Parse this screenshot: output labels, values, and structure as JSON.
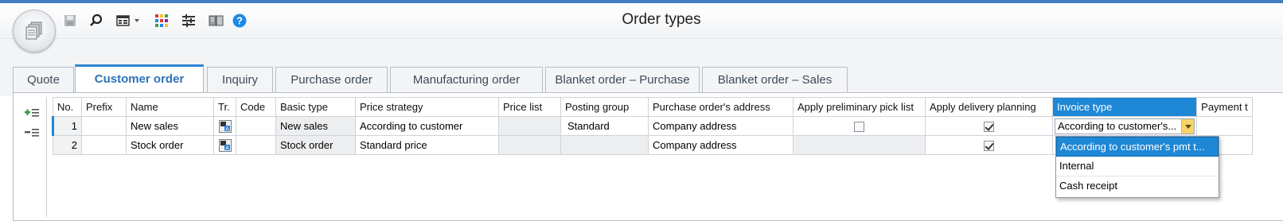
{
  "window": {
    "title": "Order types",
    "accent_color": "#3f7fbf"
  },
  "quick_access": {
    "icons": [
      "save-icon",
      "search-icon",
      "view-icon",
      "dropdown-arrow-icon",
      "color-grid-icon",
      "list-settings-icon",
      "book-icon",
      "help-icon"
    ]
  },
  "tabs": [
    {
      "label": "Quote"
    },
    {
      "label": "Customer order",
      "active": true
    },
    {
      "label": "Inquiry"
    },
    {
      "label": "Purchase order"
    },
    {
      "label": "Manufacturing order"
    },
    {
      "label": "Blanket order – Purchase"
    },
    {
      "label": "Blanket order – Sales"
    }
  ],
  "grid": {
    "columns": [
      "No.",
      "Prefix",
      "Name",
      "Tr.",
      "Code",
      "Basic type",
      "Price strategy",
      "Price list",
      "Posting group",
      "Purchase order's address",
      "Apply preliminary pick list",
      "Apply delivery planning",
      "Invoice type",
      "Payment t"
    ],
    "selected_column": "Invoice type",
    "rows": [
      {
        "no": "1",
        "prefix": "",
        "name": "New sales",
        "code": "",
        "basic_type": "New sales",
        "price_strategy": "According to customer",
        "price_list": "",
        "posting_group": "Standard",
        "address": "Company address",
        "apply_pick_list": false,
        "apply_delivery_planning": true,
        "invoice_type": "According to customer's...",
        "payment": ""
      },
      {
        "no": "2",
        "prefix": "",
        "name": "Stock order",
        "code": "",
        "basic_type": "Stock order",
        "price_strategy": "Standard price",
        "price_list": "",
        "posting_group": "",
        "address": "Company address",
        "apply_pick_list": null,
        "apply_delivery_planning": true,
        "invoice_type": "",
        "payment": ""
      }
    ]
  },
  "invoice_dropdown": {
    "options": [
      "According to customer's pmt t...",
      "Internal",
      "Cash receipt"
    ],
    "highlighted_index": 0
  }
}
